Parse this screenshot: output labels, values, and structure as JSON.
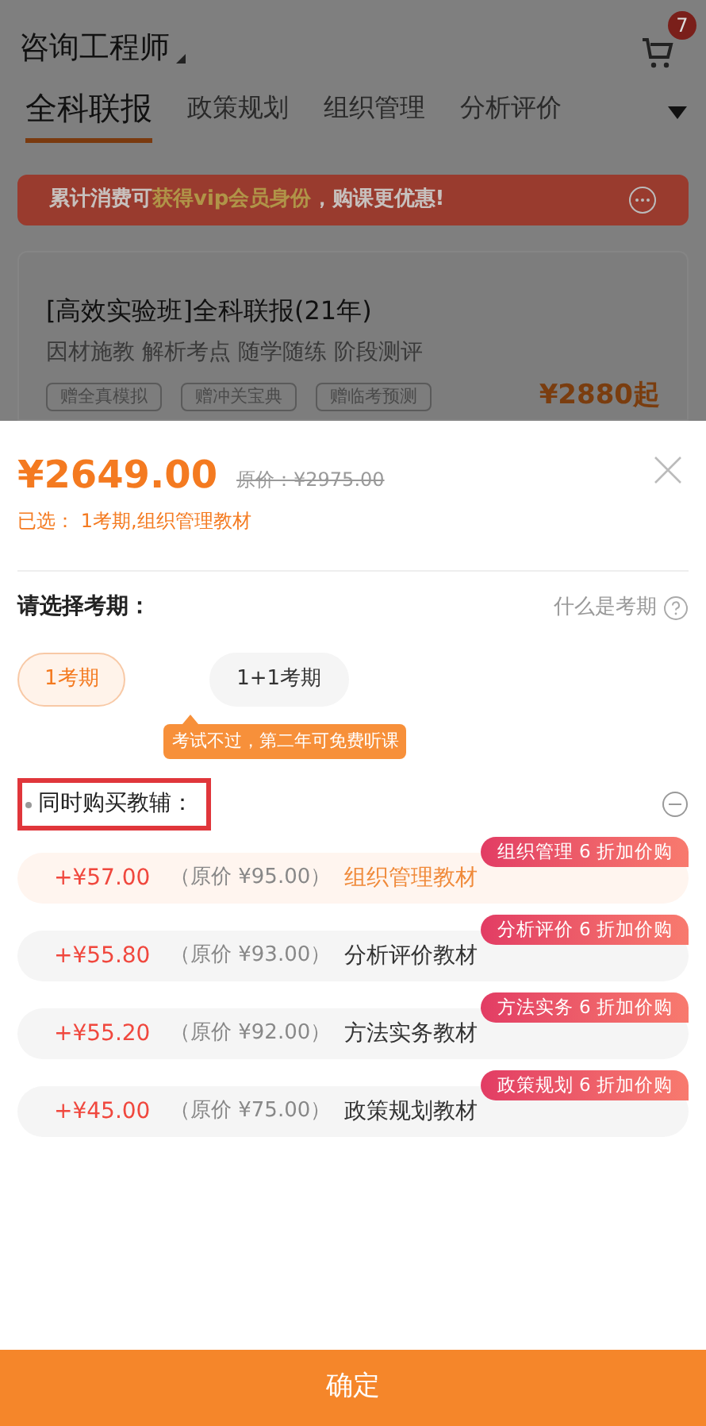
{
  "header": {
    "title": "咨询工程师",
    "cart_count": "7"
  },
  "tabs": [
    {
      "label": "全科联报",
      "selected": true
    },
    {
      "label": "政策规划",
      "selected": false
    },
    {
      "label": "组织管理",
      "selected": false
    },
    {
      "label": "分析评价",
      "selected": false
    }
  ],
  "banner": {
    "text": "累计消费可",
    "highlight": "获得vip会员身份",
    "text_after": "，购课更优惠!"
  },
  "course": {
    "title": "[高效实验班]全科联报(21年)",
    "subtitle": "因材施教 解析考点 随学随练 阶段测评",
    "tags": [
      "赠全真模拟",
      "赠冲关宝典",
      "赠临考预测"
    ],
    "price": "¥2880起"
  },
  "sheet": {
    "price": "¥2649.00",
    "original_price": "原价：¥2975.00",
    "selected_summary": "已选： 1考期,组织管理教材",
    "period_label": "请选择考期：",
    "period_help": "什么是考期",
    "periods": [
      {
        "label": "1考期",
        "selected": true
      },
      {
        "label": "1+1考期",
        "selected": false
      }
    ],
    "period_tip": "考试不过，第二年可免费听课",
    "addon_label": "同时购买教辅：",
    "addons": [
      {
        "price": "+¥57.00",
        "original": "（原价 ¥95.00）",
        "name": "组织管理教材",
        "badge": "组织管理 6 折加价购",
        "selected": true
      },
      {
        "price": "+¥55.80",
        "original": "（原价 ¥93.00）",
        "name": "分析评价教材",
        "badge": "分析评价 6 折加价购",
        "selected": false
      },
      {
        "price": "+¥55.20",
        "original": "（原价 ¥92.00）",
        "name": "方法实务教材",
        "badge": "方法实务 6 折加价购",
        "selected": false
      },
      {
        "price": "+¥45.00",
        "original": "（原价 ¥75.00）",
        "name": "政策规划教材",
        "badge": "政策规划 6 折加价购",
        "selected": false
      }
    ],
    "confirm": "确定"
  }
}
